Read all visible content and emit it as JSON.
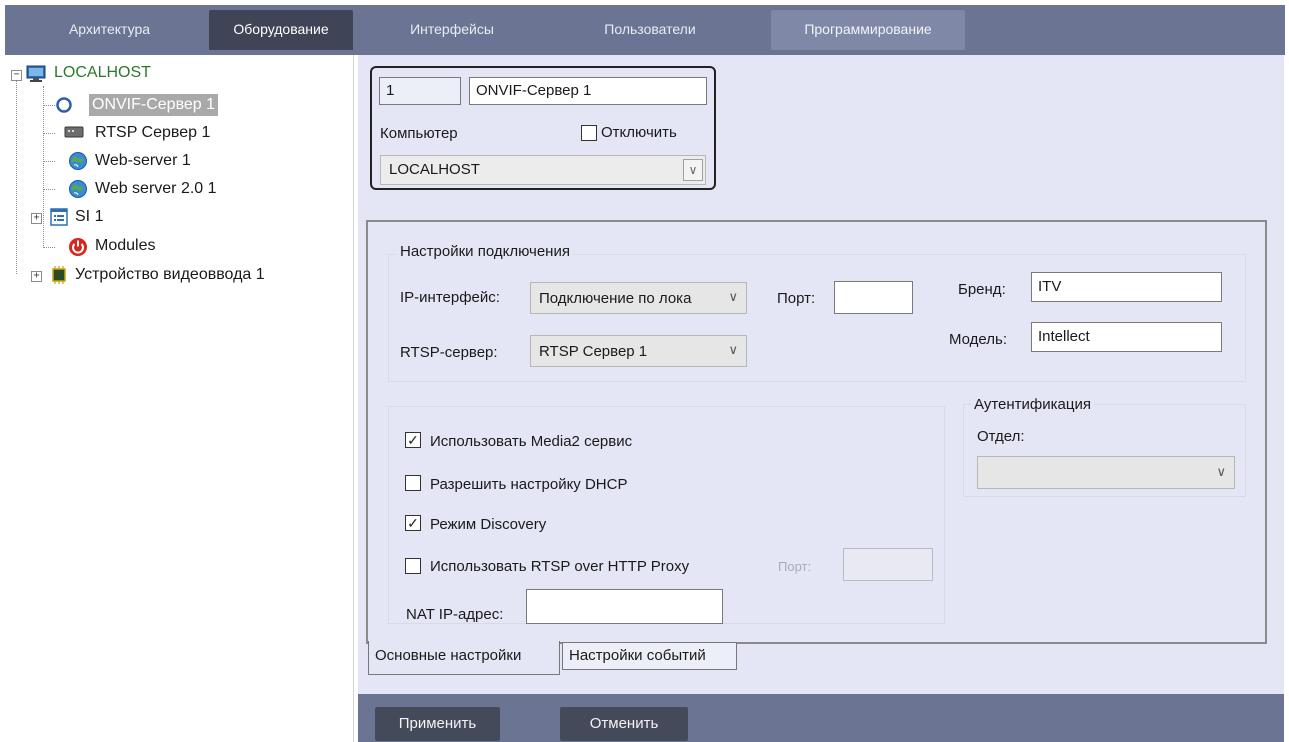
{
  "top_tabs": [
    {
      "label": "Архитектура"
    },
    {
      "label": "Оборудование"
    },
    {
      "label": "Интерфейсы"
    },
    {
      "label": "Пользователи"
    },
    {
      "label": "Программирование"
    }
  ],
  "tree": {
    "root": {
      "label": "LOCALHOST",
      "expander": "−"
    },
    "items": [
      {
        "label": "ONVIF-Сервер 1",
        "icon": "circle-icon",
        "selected": true
      },
      {
        "label": "RTSP Сервер 1",
        "icon": "server-icon"
      },
      {
        "label": "Web-server 1",
        "icon": "globe-icon"
      },
      {
        "label": "Web server 2.0 1",
        "icon": "globe-icon"
      },
      {
        "label": "SI 1",
        "icon": "list-icon",
        "expander": "+"
      },
      {
        "label": "Modules",
        "icon": "power-icon"
      },
      {
        "label": "Устройство видеоввода 1",
        "icon": "chip-icon",
        "expander": "+"
      }
    ]
  },
  "object": {
    "id": "1",
    "name": "ONVIF-Сервер 1",
    "computer_label": "Компьютер",
    "disable_label": "Отключить",
    "computer_value": "LOCALHOST"
  },
  "connection": {
    "legend": "Настройки подключения",
    "ip_label": "IP-интерфейс:",
    "ip_value": "Подключение по лока",
    "port_label": "Порт:",
    "port_value": "",
    "rtsp_label": "RTSP-сервер:",
    "rtsp_value": "RTSP Сервер 1",
    "brand_label": "Бренд:",
    "brand_value": "ITV",
    "model_label": "Модель:",
    "model_value": "Intellect"
  },
  "options": {
    "media2_label": "Использовать Media2 сервис",
    "media2_checked": true,
    "dhcp_label": "Разрешить настройку DHCP",
    "dhcp_checked": false,
    "discovery_label": "Режим Discovery",
    "discovery_checked": true,
    "proxy_label": "Использовать RTSP over HTTP Proxy",
    "proxy_checked": false,
    "proxy_port_label": "Порт:",
    "proxy_port_value": "",
    "nat_label": "NAT IP-адрес:",
    "nat_value": ""
  },
  "auth": {
    "legend": "Аутентификация",
    "department_label": "Отдел:",
    "department_value": ""
  },
  "bottom_tabs": [
    {
      "label": "Основные настройки"
    },
    {
      "label": "Настройки событий"
    }
  ],
  "buttons": {
    "apply": "Применить",
    "cancel": "Отменить"
  },
  "colors": {
    "topbar": "#6b7493",
    "active_tab": "#3f4556",
    "content_bg": "#e4e6f5",
    "root_label": "#2a7a2a",
    "selected_item": "#a9a9a9"
  }
}
